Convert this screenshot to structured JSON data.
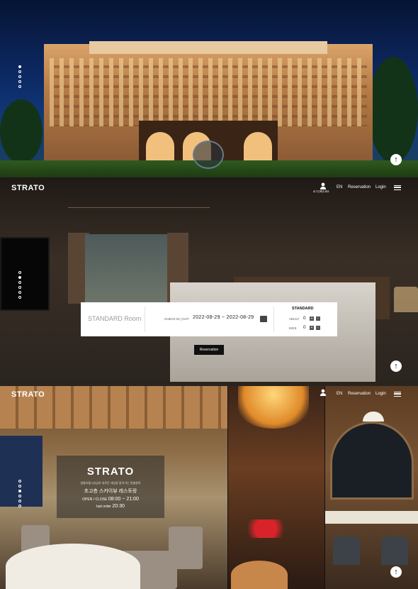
{
  "hero": {
    "dots": [
      true,
      false,
      false,
      false,
      false
    ],
    "top_button_icon": "arrow-up-icon"
  },
  "header": {
    "logo": "STRATO",
    "user_label": "로그인해주세요",
    "user_icon": "user-icon",
    "lang": "EN",
    "reservation": "Reservation",
    "login": "Login",
    "menu_icon": "hamburger-menu-icon"
  },
  "room": {
    "dots": [
      false,
      true,
      false,
      false,
      false,
      false
    ],
    "booking": {
      "room_name": "STANDARD Room",
      "checkio_label": "CHECK IN | OUT",
      "dates": "2022-08-29 ~ 2022-08-29",
      "calendar_icon": "calendar-icon",
      "room_type": "STANDARD",
      "adult_label": "ADULT",
      "adult_value": "0",
      "kids_label": "KIDS",
      "kids_value": "0",
      "plus": "+",
      "minus": "-"
    },
    "reservation_button": "Reservation"
  },
  "dining": {
    "logo": "STRATO",
    "nav_lang": "EN",
    "nav_reservation": "Reservation",
    "nav_login": "Login",
    "info": {
      "logo": "STRATO",
      "description": "샘물호텔 5성급의 새로운 세상을 맡아가는 맞춤형의",
      "name": "초고층 스카이뷰 레스토랑",
      "hours_label": "OPEN / CLOSE",
      "hours": "08:00 ~ 21:00",
      "last_label": "last order",
      "last": "20:30"
    },
    "dots": [
      false,
      false,
      true,
      false,
      false,
      false
    ]
  },
  "colors": {
    "accent": "#111111",
    "white": "#ffffff"
  }
}
